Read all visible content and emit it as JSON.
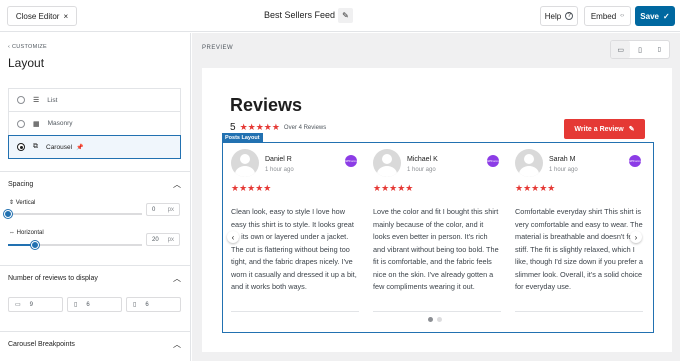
{
  "topbar": {
    "close_label": "Close Editor",
    "close_icon": "×",
    "feed_title": "Best Sellers Feed",
    "edit_icon": "✎",
    "help_label": "Help",
    "help_icon": "?",
    "embed_label": "Embed",
    "embed_icon": "‹›",
    "save_label": "Save",
    "save_icon": "✓"
  },
  "sidebar": {
    "crumb": "‹ CUSTOMIZE",
    "title": "Layout",
    "options": [
      {
        "label": "List",
        "icon": "☰",
        "selected": false
      },
      {
        "label": "Masonry",
        "icon": "▦",
        "selected": false
      },
      {
        "label": "Carousel",
        "icon": "⧉",
        "selected": true,
        "pin": "📌"
      }
    ],
    "spacing": {
      "heading": "Spacing",
      "vertical": {
        "label": "Vertical",
        "icon": "⇕",
        "value": "0",
        "unit": "px"
      },
      "horizontal": {
        "label": "Horizontal",
        "icon": "⇔",
        "value": "20",
        "unit": "px"
      }
    },
    "num_reviews": {
      "heading": "Number of reviews to display",
      "desktop": {
        "icon": "▭",
        "value": "9"
      },
      "tablet": {
        "icon": "▯",
        "value": "6"
      },
      "mobile": {
        "icon": "▯",
        "value": "6"
      }
    },
    "breakpoints": {
      "heading": "Carousel Breakpoints"
    },
    "chevron_up": "︿"
  },
  "preview": {
    "label": "PREVIEW",
    "devices": [
      "▭",
      "▯",
      "▯"
    ],
    "reviews_title": "Reviews",
    "score": "5",
    "stars": "★★★★★",
    "count": "Over 4 Reviews",
    "write_label": "Write a Review",
    "write_icon": "✎",
    "posts_tag": "Posts Layout",
    "prev_arrow": "‹",
    "next_arrow": "›",
    "badge_text": "WPForms",
    "cards": [
      {
        "name": "Daniel R",
        "time": "1 hour ago",
        "stars": "★★★★★",
        "text": "Clean look, easy to style I love how easy this shirt is to style. It looks great on its own or layered under a jacket. The cut is flattering without being too tight, and the fabric drapes nicely. I've worn it casually and dressed it up a bit, and it works both ways."
      },
      {
        "name": "Michael K",
        "time": "1 hour ago",
        "stars": "★★★★★",
        "text": "Love the color and fit I bought this shirt mainly because of the color, and it looks even better in person. It's rich and vibrant without being too bold. The fit is comfortable, and the fabric feels nice on the skin. I've already gotten a few compliments wearing it out."
      },
      {
        "name": "Sarah M",
        "time": "1 hour ago",
        "stars": "★★★★★",
        "text": "Comfortable everyday shirt This shirt is very comfortable and easy to wear. The material is breathable and doesn't feel stiff. The fit is slightly relaxed, which I like, though I'd size down if you prefer a slimmer look. Overall, it's a solid choice for everyday use."
      }
    ]
  }
}
